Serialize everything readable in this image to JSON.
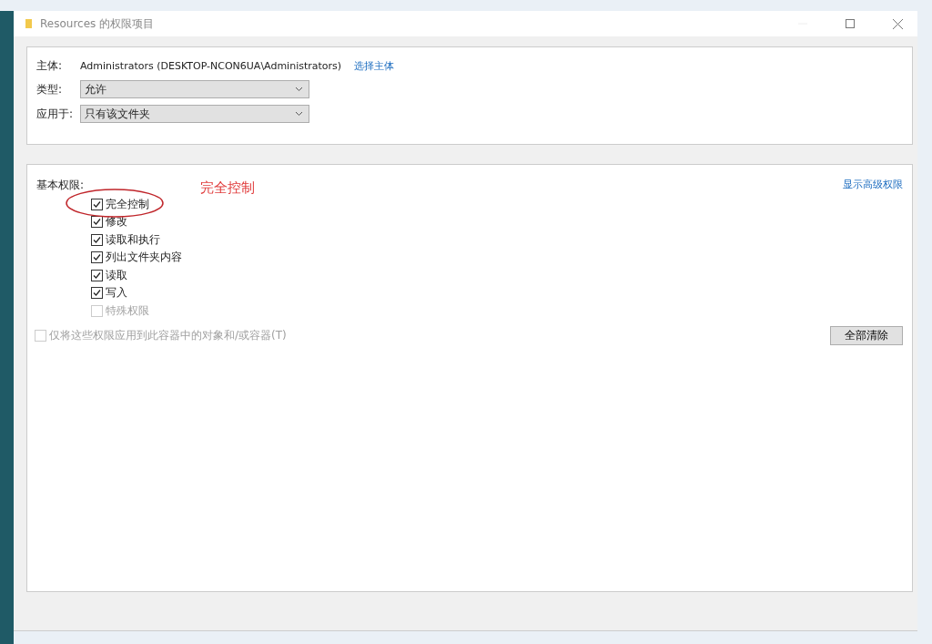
{
  "window": {
    "title": "Resources 的权限项目"
  },
  "principal": {
    "label": "主体:",
    "value": "Administrators (DESKTOP-NCON6UA\\Administrators)",
    "link": "选择主体"
  },
  "fields": [
    {
      "label": "类型:",
      "value": "允许"
    },
    {
      "label": "应用于:",
      "value": "只有该文件夹"
    }
  ],
  "permissions": {
    "title": "基本权限:",
    "link": "显示高级权限",
    "items": [
      {
        "label": "完全控制",
        "checked": true,
        "disabled": false
      },
      {
        "label": "修改",
        "checked": true,
        "disabled": false
      },
      {
        "label": "读取和执行",
        "checked": true,
        "disabled": false
      },
      {
        "label": "列出文件夹内容",
        "checked": true,
        "disabled": false
      },
      {
        "label": "读取",
        "checked": true,
        "disabled": false
      },
      {
        "label": "写入",
        "checked": true,
        "disabled": false
      },
      {
        "label": "特殊权限",
        "checked": false,
        "disabled": true
      }
    ],
    "apply_only": {
      "label": "仅将这些权限应用到此容器中的对象和/或容器(T)",
      "checked": false,
      "disabled": true
    },
    "clear_button": "全部清除"
  },
  "annotation": {
    "text": "完全控制"
  }
}
